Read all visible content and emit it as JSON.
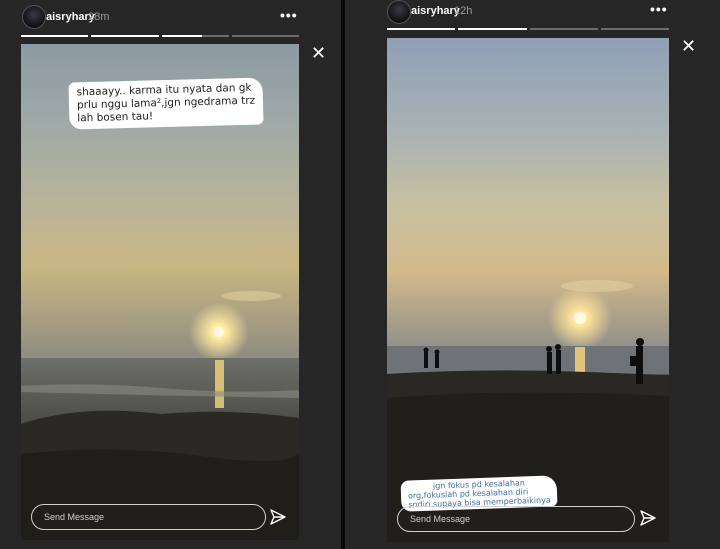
{
  "stories": [
    {
      "username": "aisryhary",
      "time": "28m",
      "more": "•••",
      "close": "✕",
      "caption_lines": [
        "shaaayy.. karma itu nyata dan gk",
        "prlu nggu lama²,jgn ngedrama trz",
        "lah bosen tau!"
      ],
      "reply_placeholder": "Send Message",
      "progress": [
        "full",
        "full",
        "part",
        "empty"
      ]
    },
    {
      "username": "aisryhary",
      "time": "12h",
      "more": "•••",
      "close": "✕",
      "caption_lines": [
        "jgn fokus pd kesalahan",
        "org,fokuslah pd kesalahan diri",
        "sndiri supaya bisa memperbaikinya"
      ],
      "reply_placeholder": "Send Message",
      "progress": [
        "full",
        "full",
        "empty",
        "empty"
      ]
    }
  ],
  "colors": {
    "background": "#1c1c1c",
    "panel": "#262626",
    "caption_text_2": "#3f6f9a"
  },
  "icons": {
    "send": "send-icon",
    "close": "close-icon",
    "more": "more-options-icon"
  }
}
